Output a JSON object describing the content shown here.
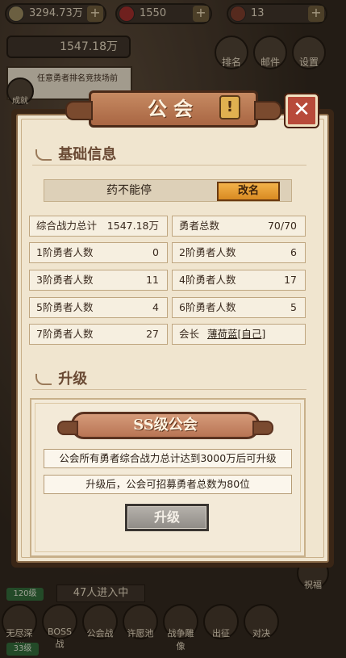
{
  "top_bar": {
    "gold": "3294.73万",
    "gems": "1550",
    "third": "13",
    "power": "1547.18万",
    "rank_label": "排名",
    "mail_label": "邮件",
    "settings_label": "设置",
    "notice_text": "任意勇者排名竞技场前",
    "achievement_label": "成就"
  },
  "dialog": {
    "title": "公会",
    "title_badge": "!",
    "close_icon": "close-icon",
    "basic_section_title": "基础信息",
    "guild_name": "药不能停",
    "rename_label": "改名",
    "stats": {
      "total_power_label": "综合战力总计",
      "total_power_value": "1547.18万",
      "total_heroes_label": "勇者总数",
      "total_heroes_value": "70/70",
      "tier1_label": "1阶勇者人数",
      "tier1_value": "0",
      "tier2_label": "2阶勇者人数",
      "tier2_value": "6",
      "tier3_label": "3阶勇者人数",
      "tier3_value": "11",
      "tier4_label": "4阶勇者人数",
      "tier4_value": "17",
      "tier5_label": "5阶勇者人数",
      "tier5_value": "4",
      "tier6_label": "6阶勇者人数",
      "tier6_value": "5",
      "tier7_label": "7阶勇者人数",
      "tier7_value": "27",
      "leader_label": "会长",
      "leader_name": "薄荷蓝[自己]"
    },
    "upgrade_section_title": "升级",
    "guild_rank": "SS级公会",
    "requirement_text": "公会所有勇者综合战力总计达到3000万后可升级",
    "benefit_text": "升级后，公会可招募勇者总数为80位",
    "upgrade_button_label": "升级"
  },
  "bottom": {
    "enter_tag": "47人进入中",
    "level_tag": "120级",
    "level_tag2": "33级",
    "side_label": "祝福",
    "nav_items": [
      "无尽深渊",
      "BOSS战",
      "公会战",
      "许愿池",
      "战争雕像",
      "出征",
      "对决"
    ]
  },
  "colors": {
    "panel_bg": "#f0e5cf",
    "frame": "#3a2616",
    "banner": "#b8704f",
    "rename_button": "#e89a30",
    "close_button": "#b84a3a",
    "upgrade_button_disabled": "#a09c96"
  }
}
